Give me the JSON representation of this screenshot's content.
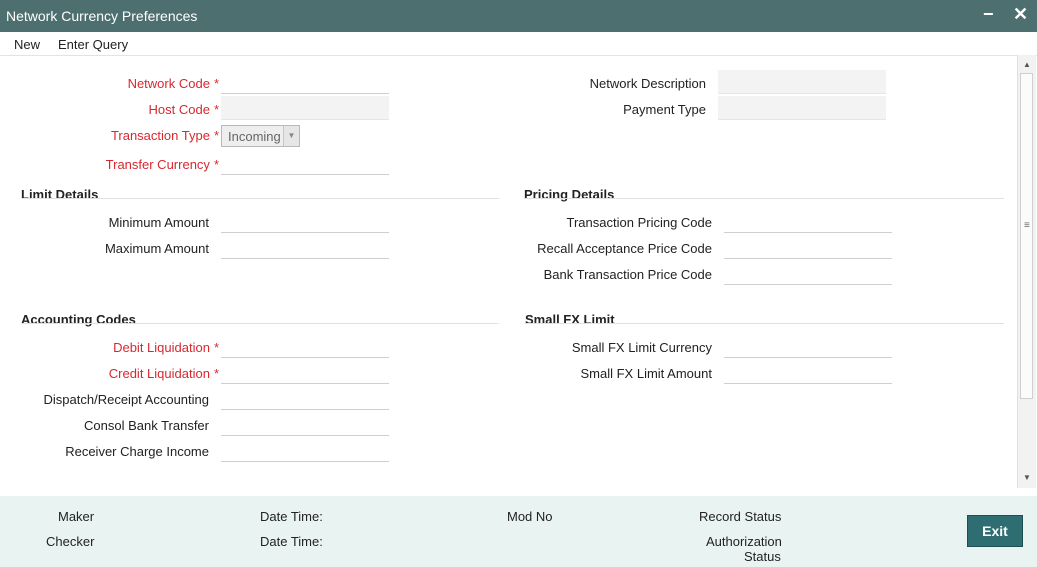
{
  "window": {
    "title": "Network Currency Preferences",
    "minimize_icon": "minus-icon",
    "close_icon": "close-x-icon",
    "minimize_glyph": "−",
    "close_glyph": "✕"
  },
  "menu": {
    "new": "New",
    "enter_query": "Enter Query"
  },
  "main": {
    "network_code_label": "Network Code",
    "host_code_label": "Host Code",
    "transaction_type_label": "Transaction Type",
    "transaction_type_value": "Incoming",
    "transfer_currency_label": "Transfer Currency",
    "network_description_label": "Network Description",
    "payment_type_label": "Payment Type",
    "required_mark": "*"
  },
  "limit_details": {
    "title": "Limit Details",
    "minimum_amount": "Minimum Amount",
    "maximum_amount": "Maximum Amount"
  },
  "pricing_details": {
    "title": "Pricing Details",
    "transaction_pricing_code": "Transaction Pricing Code",
    "recall_acceptance_price_code": "Recall Acceptance Price Code",
    "bank_transaction_price_code": "Bank Transaction Price Code"
  },
  "accounting_codes": {
    "title": "Accounting Codes",
    "debit_liquidation": "Debit Liquidation",
    "credit_liquidation": "Credit Liquidation",
    "dispatch_receipt_accounting": "Dispatch/Receipt Accounting",
    "consol_bank_transfer": "Consol Bank Transfer",
    "receiver_charge_income": "Receiver Charge Income"
  },
  "small_fx_limit": {
    "title": "Small FX Limit",
    "currency": "Small FX Limit Currency",
    "amount": "Small FX Limit Amount"
  },
  "footer": {
    "maker": "Maker",
    "checker": "Checker",
    "date_time_1": "Date Time:",
    "date_time_2": "Date Time:",
    "mod_no": "Mod No",
    "record_status": "Record Status",
    "authorization_status_1": "Authorization",
    "authorization_status_2": "Status",
    "exit_label": "Exit"
  },
  "colors": {
    "titlebar": "#4d6f70",
    "required": "#d8282f",
    "footer_bg": "#e9f4f2",
    "exit_button": "#2e6d72"
  }
}
